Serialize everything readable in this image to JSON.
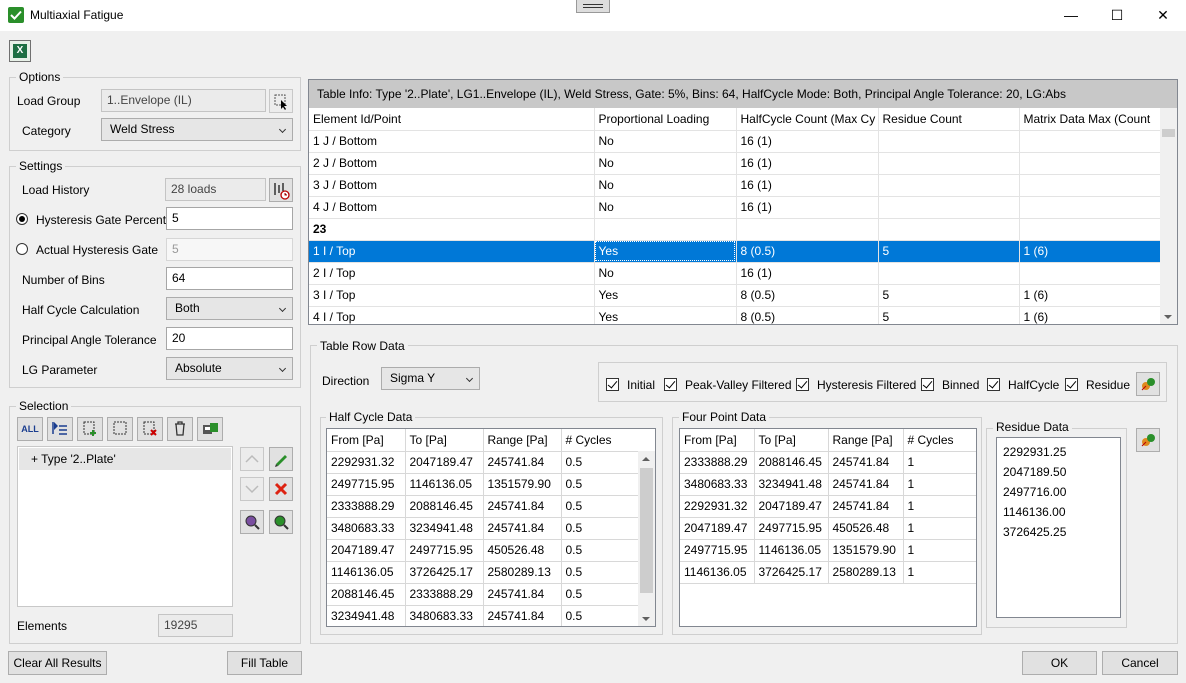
{
  "window": {
    "title": "Multiaxial Fatigue",
    "minimize": "—",
    "maximize": "☐",
    "close": "✕"
  },
  "toolbar": {
    "excel_icon": "excel-icon",
    "excel_glyph": "X"
  },
  "options": {
    "group_label": "Options",
    "load_group_label": "Load Group",
    "load_group_value": "1..Envelope (IL)",
    "category_label": "Category",
    "category_value": "Weld Stress"
  },
  "settings": {
    "group_label": "Settings",
    "load_history_label": "Load History",
    "load_history_value": "28 loads",
    "hyst_percent_label": "Hysteresis Gate Percent",
    "hyst_percent_value": "5",
    "actual_hyst_label": "Actual Hysteresis Gate",
    "actual_hyst_value": "5",
    "bins_label": "Number of Bins",
    "bins_value": "64",
    "halfcycle_label": "Half Cycle Calculation",
    "halfcycle_value": "Both",
    "pat_label": "Principal Angle Tolerance",
    "pat_value": "20",
    "lg_label": "LG Parameter",
    "lg_value": "Absolute"
  },
  "selection": {
    "group_label": "Selection",
    "all_button": "ALL",
    "tree_item": "+ Type '2..Plate'",
    "elements_label": "Elements",
    "elements_value": "19295"
  },
  "table_info": "Table Info: Type '2..Plate', LG1..Envelope (IL), Weld Stress, Gate: 5%, Bins: 64, HalfCycle Mode: Both, Principal Angle Tolerance: 20, LG:Abs",
  "main_table": {
    "headers": [
      "Element Id/Point",
      "Proportional Loading",
      "HalfCycle Count (Max Cy",
      "Residue Count",
      "Matrix Data Max (Count"
    ],
    "rows": [
      [
        "1 J / Bottom",
        "No",
        "16 (1)",
        "",
        ""
      ],
      [
        "2 J / Bottom",
        "No",
        "16 (1)",
        "",
        ""
      ],
      [
        "3 J / Bottom",
        "No",
        "16 (1)",
        "",
        ""
      ],
      [
        "4 J / Bottom",
        "No",
        "16 (1)",
        "",
        ""
      ],
      [
        "23",
        "",
        "",
        "",
        ""
      ],
      [
        "1 I / Top",
        "Yes",
        "8 (0.5)",
        "5",
        "1 (6)"
      ],
      [
        "2 I / Top",
        "No",
        "16 (1)",
        "",
        ""
      ],
      [
        "3 I / Top",
        "Yes",
        "8 (0.5)",
        "5",
        "1 (6)"
      ],
      [
        "4 I / Top",
        "Yes",
        "8 (0.5)",
        "5",
        "1 (6)"
      ]
    ]
  },
  "row_data": {
    "group_label": "Table Row Data",
    "direction_label": "Direction",
    "direction_value": "Sigma Y",
    "checks": [
      "Initial",
      "Peak-Valley Filtered",
      "Hysteresis Filtered",
      "Binned",
      "HalfCycle",
      "Residue"
    ]
  },
  "half_cycle": {
    "group_label": "Half Cycle Data",
    "headers": [
      "From  [Pa]",
      "To  [Pa]",
      "Range  [Pa]",
      "# Cycles"
    ],
    "rows": [
      [
        "2292931.32",
        "2047189.47",
        "245741.84",
        "0.5"
      ],
      [
        "2497715.95",
        "1146136.05",
        "1351579.90",
        "0.5"
      ],
      [
        "2333888.29",
        "2088146.45",
        "245741.84",
        "0.5"
      ],
      [
        "3480683.33",
        "3234941.48",
        "245741.84",
        "0.5"
      ],
      [
        "2047189.47",
        "2497715.95",
        "450526.48",
        "0.5"
      ],
      [
        "1146136.05",
        "3726425.17",
        "2580289.13",
        "0.5"
      ],
      [
        "2088146.45",
        "2333888.29",
        "245741.84",
        "0.5"
      ],
      [
        "3234941.48",
        "3480683.33",
        "245741.84",
        "0.5"
      ]
    ]
  },
  "four_point": {
    "group_label": "Four Point Data",
    "headers": [
      "From  [Pa]",
      "To  [Pa]",
      "Range  [Pa]",
      "# Cycles"
    ],
    "rows": [
      [
        "2333888.29",
        "2088146.45",
        "245741.84",
        "1"
      ],
      [
        "3480683.33",
        "3234941.48",
        "245741.84",
        "1"
      ],
      [
        "2292931.32",
        "2047189.47",
        "245741.84",
        "1"
      ],
      [
        "2047189.47",
        "2497715.95",
        "450526.48",
        "1"
      ],
      [
        "2497715.95",
        "1146136.05",
        "1351579.90",
        "1"
      ],
      [
        "1146136.05",
        "3726425.17",
        "2580289.13",
        "1"
      ]
    ]
  },
  "residue": {
    "group_label": "Residue Data",
    "values": [
      "2292931.25",
      "2047189.50",
      "2497716.00",
      "1146136.00",
      "3726425.25"
    ]
  },
  "footer": {
    "clear_all": "Clear All Results",
    "fill_table": "Fill Table",
    "ok": "OK",
    "cancel": "Cancel"
  },
  "colors": {
    "selection": "#0078d7",
    "header_bar": "#c8c8c8",
    "excel_green": "#1d6f42",
    "title_check": "#2a8f2a"
  }
}
